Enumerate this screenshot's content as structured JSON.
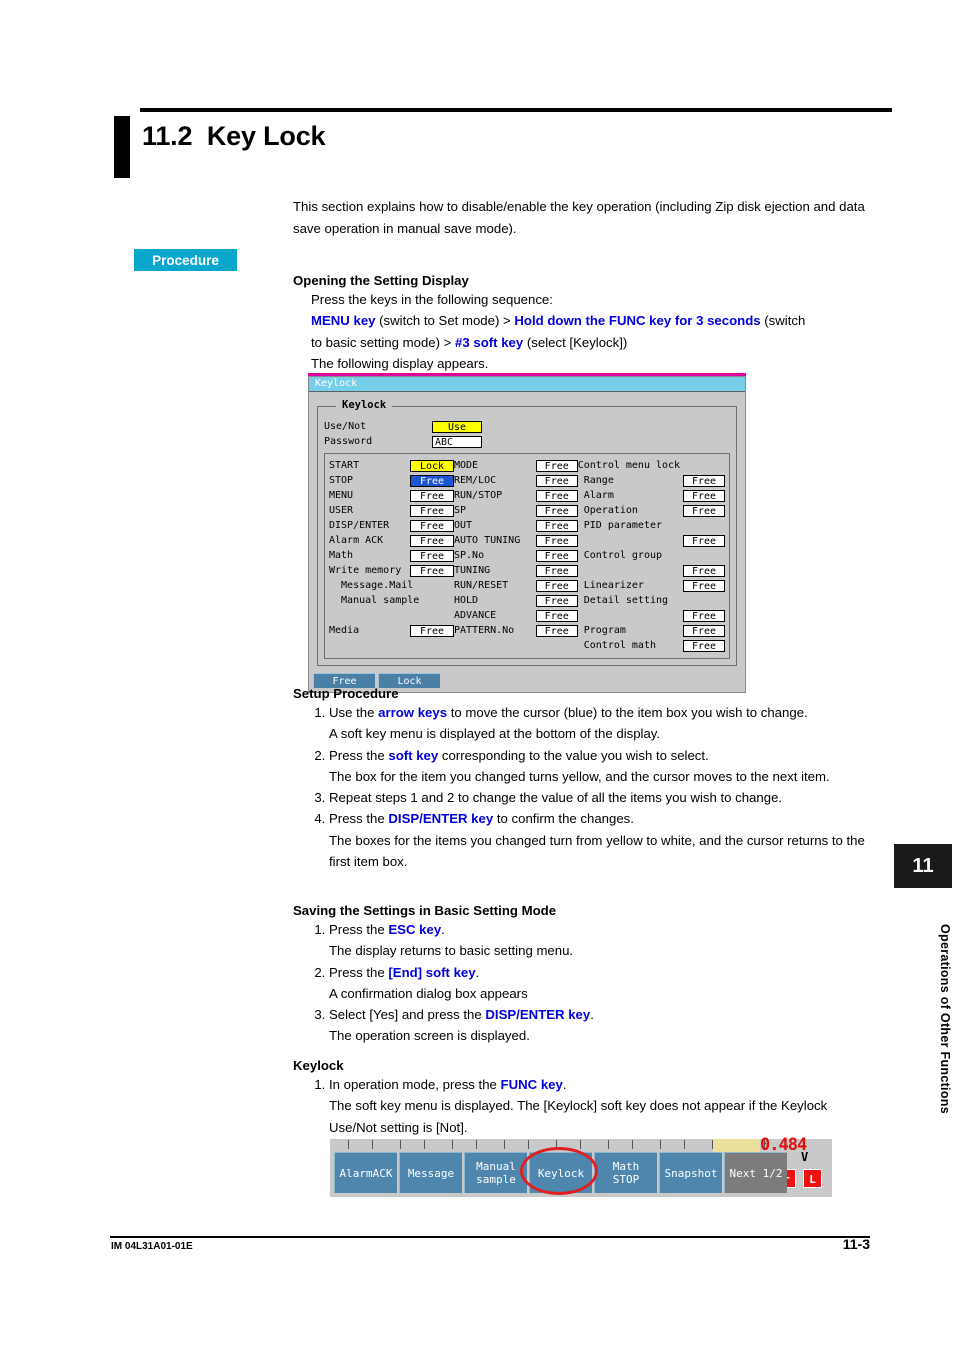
{
  "heading": {
    "number": "11.2",
    "title": "Key Lock"
  },
  "intro": "This section explains how to disable/enable the key operation (including Zip disk ejection and data save operation in manual save mode).",
  "procedure_badge": "Procedure",
  "opening": {
    "heading": "Opening the Setting Display",
    "line1": "Press the keys in the following sequence:",
    "seq_menu_key": "MENU key",
    "seq_t1": " (switch to Set mode) > ",
    "seq_hold_func": "Hold down the FUNC key for 3 seconds",
    "seq_t2": " (switch",
    "seq_t3": "to basic setting mode) > ",
    "seq_soft3": "#3 soft key",
    "seq_t4": " (select [Keylock])",
    "line_end": "The following display appears."
  },
  "device": {
    "titlebar": "Keylock",
    "panel_legend": "Keylock",
    "use_not_label": "Use/Not",
    "use_not_value": "Use",
    "password_label": "Password",
    "password_value": "ABC",
    "column_a": [
      {
        "label": "START",
        "value": "Lock",
        "state": "yellow"
      },
      {
        "label": "STOP",
        "value": "Free",
        "state": "cursor"
      },
      {
        "label": "MENU",
        "value": "Free",
        "state": "plain"
      },
      {
        "label": "USER",
        "value": "Free",
        "state": "plain"
      },
      {
        "label": "DISP/ENTER",
        "value": "Free",
        "state": "plain"
      },
      {
        "label": "Alarm ACK",
        "value": "Free",
        "state": "plain"
      },
      {
        "label": "Math",
        "value": "Free",
        "state": "plain"
      },
      {
        "label": "Write memory",
        "value": "Free",
        "state": "plain"
      },
      {
        "label": "  Message.Mail",
        "value": "",
        "state": "none"
      },
      {
        "label": "  Manual sample",
        "value": "",
        "state": "none"
      },
      {
        "label": "",
        "value": "",
        "state": "none"
      },
      {
        "label": "Media",
        "value": "Free",
        "state": "plain"
      }
    ],
    "column_b": [
      {
        "label": "MODE",
        "value": "Free",
        "state": "plain"
      },
      {
        "label": "REM/LOC",
        "value": "Free",
        "state": "plain"
      },
      {
        "label": "RUN/STOP",
        "value": "Free",
        "state": "plain"
      },
      {
        "label": "SP",
        "value": "Free",
        "state": "plain"
      },
      {
        "label": "OUT",
        "value": "Free",
        "state": "plain"
      },
      {
        "label": "AUTO TUNING",
        "value": "Free",
        "state": "plain"
      },
      {
        "label": "SP.No",
        "value": "Free",
        "state": "plain"
      },
      {
        "label": "TUNING",
        "value": "Free",
        "state": "plain"
      },
      {
        "label": "RUN/RESET",
        "value": "Free",
        "state": "plain"
      },
      {
        "label": "HOLD",
        "value": "Free",
        "state": "plain"
      },
      {
        "label": "ADVANCE",
        "value": "Free",
        "state": "plain"
      },
      {
        "label": "PATTERN.No",
        "value": "Free",
        "state": "plain"
      }
    ],
    "column_c": [
      {
        "label": "Control menu lock",
        "value": "",
        "state": "none"
      },
      {
        "label": " Range",
        "value": "Free",
        "state": "plain"
      },
      {
        "label": " Alarm",
        "value": "Free",
        "state": "plain"
      },
      {
        "label": " Operation",
        "value": "Free",
        "state": "plain"
      },
      {
        "label": " PID parameter",
        "value": "",
        "state": "none"
      },
      {
        "label": "",
        "value": "Free",
        "state": "plain"
      },
      {
        "label": " Control group",
        "value": "",
        "state": "none"
      },
      {
        "label": "",
        "value": "Free",
        "state": "plain"
      },
      {
        "label": " Linearizer",
        "value": "Free",
        "state": "plain"
      },
      {
        "label": " Detail setting",
        "value": "",
        "state": "none"
      },
      {
        "label": "",
        "value": "Free",
        "state": "plain"
      },
      {
        "label": " Program",
        "value": "Free",
        "state": "plain"
      },
      {
        "label": " Control math",
        "value": "Free",
        "state": "plain"
      }
    ],
    "softkeys": [
      "Free",
      "Lock"
    ]
  },
  "setup": {
    "heading": "Setup Procedure",
    "steps": [
      {
        "pre": "Use the ",
        "key": "arrow keys",
        "post": " to move the cursor (blue) to the item box you wish to change.",
        "sub": "A soft key menu is displayed at the bottom of the display."
      },
      {
        "pre": "Press the ",
        "key": "soft key",
        "post": " corresponding to the value you wish to select.",
        "sub": "The box for the item you changed turns yellow, and the cursor moves to the next item."
      },
      {
        "pre": "Repeat steps 1 and 2 to change the value of all the items you wish to change.",
        "key": "",
        "post": "",
        "sub": ""
      },
      {
        "pre": "Press the ",
        "key": "DISP/ENTER key",
        "post": " to confirm the changes.",
        "sub": "The boxes for the items you changed turn from yellow to white, and the cursor returns to the first item box."
      }
    ]
  },
  "saving": {
    "heading": "Saving the Settings in Basic Setting Mode",
    "steps": [
      {
        "pre": "Press the ",
        "key": "ESC key",
        "post": ".",
        "sub": "The display returns to basic setting menu."
      },
      {
        "pre": "Press the ",
        "key": "[End] soft key",
        "post": ".",
        "sub": "A confirmation dialog box appears"
      },
      {
        "pre": "Select [Yes] and press the ",
        "key": "DISP/ENTER key",
        "post": ".",
        "sub": "The operation screen is displayed."
      }
    ]
  },
  "keylock_section": {
    "heading": "Keylock",
    "steps": [
      {
        "pre": "In operation mode, press the ",
        "key": "FUNC key",
        "post": ".",
        "sub": "The soft key menu is displayed.  The [Keylock] soft key does not appear if the Keylock Use/Not setting is [Not]."
      }
    ]
  },
  "softkey_figure": {
    "keys": [
      {
        "line1": "AlarmACK",
        "line2": "",
        "style": "blue"
      },
      {
        "line1": "Message",
        "line2": "",
        "style": "blue"
      },
      {
        "line1": "Manual",
        "line2": "sample",
        "style": "blue"
      },
      {
        "line1": "Keylock",
        "line2": "",
        "style": "blue"
      },
      {
        "line1": "Math",
        "line2": "STOP",
        "style": "blue"
      },
      {
        "line1": "Snapshot",
        "line2": "",
        "style": "blue"
      },
      {
        "line1": "Next 1/2",
        "line2": "",
        "style": "grey"
      }
    ],
    "value": "0.484",
    "unit": "V",
    "red_button_1": "r",
    "red_button_2": "L",
    "highlight_color": "#e02020"
  },
  "side_tab": {
    "number": "11",
    "text": "Operations of Other Functions"
  },
  "footer": {
    "doc_id": "IM 04L31A01-01E",
    "page": "11-3"
  }
}
